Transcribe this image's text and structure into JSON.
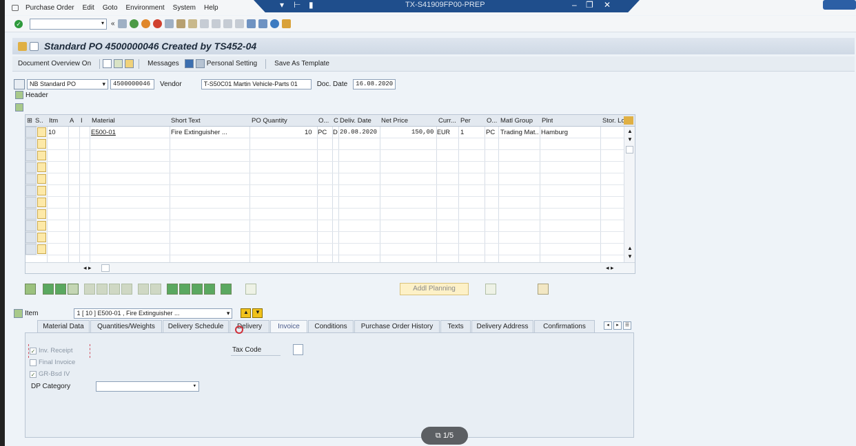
{
  "menu": {
    "items": [
      "Purchase Order",
      "Edit",
      "Goto",
      "Environment",
      "System",
      "Help"
    ]
  },
  "window": {
    "system_id": "TX-S41909FP00-PREP"
  },
  "title": "Standard PO 4500000046 Created by TS452-04",
  "appbar": {
    "doc_overview": "Document Overview On",
    "messages": "Messages",
    "personal_setting": "Personal Setting",
    "save_template": "Save As Template"
  },
  "header": {
    "doc_type": "NB Standard PO",
    "po_number": "4500000046",
    "vendor_label": "Vendor",
    "vendor_value": "T-S50C01 Martin Vehicle-Parts 01",
    "doc_date_label": "Doc. Date",
    "doc_date_value": "16.08.2020",
    "header_label": "Header"
  },
  "grid": {
    "columns": [
      "S..",
      "Itm",
      "A",
      "I",
      "Material",
      "Short Text",
      "PO Quantity",
      "O...",
      "C",
      "Deliv. Date",
      "Net Price",
      "Curr...",
      "Per",
      "O...",
      "Matl Group",
      "Plnt",
      "Stor. Lo"
    ],
    "row": {
      "itm": "10",
      "material": "E500-01",
      "short_text": "Fire Extinguisher ...",
      "po_quantity": "10",
      "order_unit": "PC",
      "cat": "D",
      "deliv_date": "20.08.2020",
      "net_price": "150,00",
      "currency": "EUR",
      "per": "1",
      "order_price_unit": "PC",
      "matl_group": "Trading Mat..",
      "plant": "Hamburg"
    }
  },
  "addl_planning": "Addl Planning",
  "item": {
    "label": "Item",
    "selected": "1 [ 10 ] E500-01 , Fire Extinguisher ..."
  },
  "tabs": [
    "Material Data",
    "Quantities/Weights",
    "Delivery Schedule",
    "Delivery",
    "Invoice",
    "Conditions",
    "Purchase Order History",
    "Texts",
    "Delivery Address",
    "Confirmations"
  ],
  "invoice_tab": {
    "inv_receipt": "Inv. Receipt",
    "final_invoice": "Final Invoice",
    "gr_bsd_iv": "GR-Bsd IV",
    "dp_category": "DP Category",
    "tax_code": "Tax Code"
  },
  "pager": "1/5"
}
